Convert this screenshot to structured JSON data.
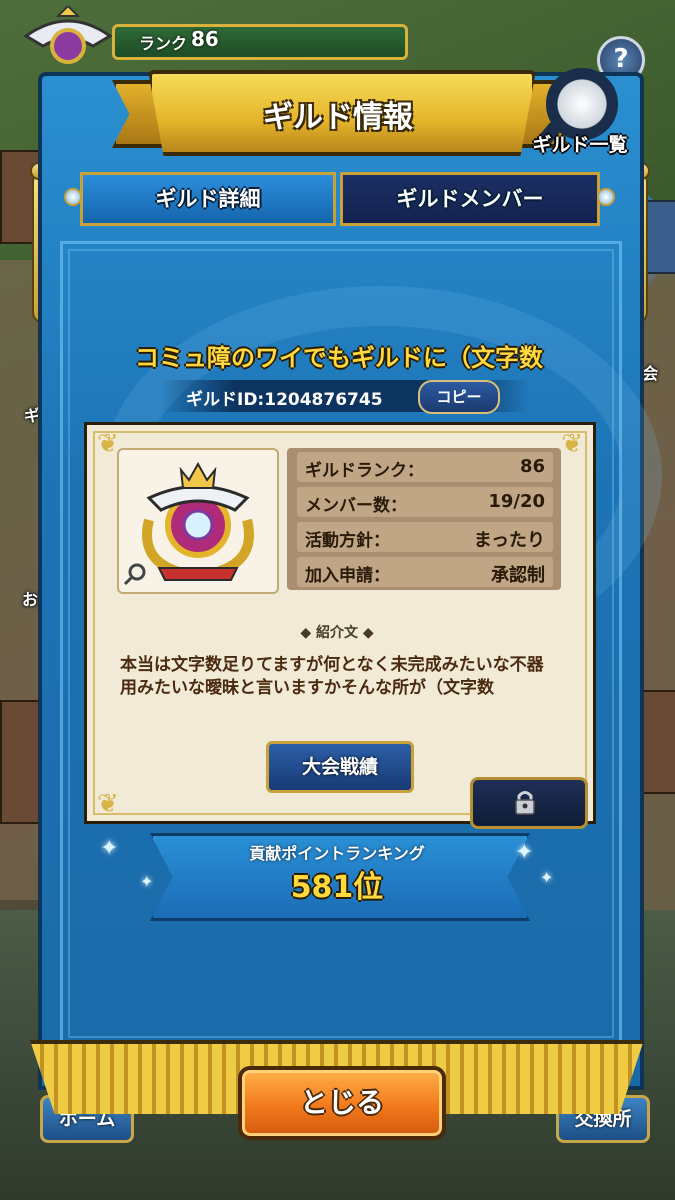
{
  "hud": {
    "rank_label": "ランク",
    "rank_value": "86",
    "help_icon": "help-icon",
    "side_labels": [
      "ギル",
      "おた",
      "大会"
    ]
  },
  "bottom_nav": {
    "home": "ホーム",
    "exchange": "交換所"
  },
  "dialog": {
    "title": "ギルド情報",
    "guild_list_label": "ギルド一覧",
    "tabs": [
      {
        "label": "ギルド詳細",
        "active": true
      },
      {
        "label": "ギルドメンバー",
        "active": false
      }
    ],
    "guild_name": "コミュ障のワイでもギルドに（文字数",
    "guild_id": "ギルドID:1204876745",
    "copy_label": "コピー",
    "stats": [
      {
        "label": "ギルドランク：",
        "value": "86"
      },
      {
        "label": "メンバー数：",
        "value": "19/20"
      },
      {
        "label": "活動方針：",
        "value": "まったり"
      },
      {
        "label": "加入申請：",
        "value": "承認制"
      }
    ],
    "intro_heading": "紹介文",
    "intro_text": "本当は文字数足りてますが何となく未完成みたいな不器用みたいな曖昧と言いますかそんな所が（文字数",
    "tournament_button": "大会戦績",
    "ranking_label": "貢献ポイントランキング",
    "ranking_value": "581位",
    "close_button": "とじる"
  },
  "colors": {
    "banner_blue": "#1d74b5",
    "ribbon_gold": "#e4b52a",
    "name_yellow": "#ffd93e",
    "close_orange": "#f2791b",
    "card_bg": "#f1ead6"
  }
}
